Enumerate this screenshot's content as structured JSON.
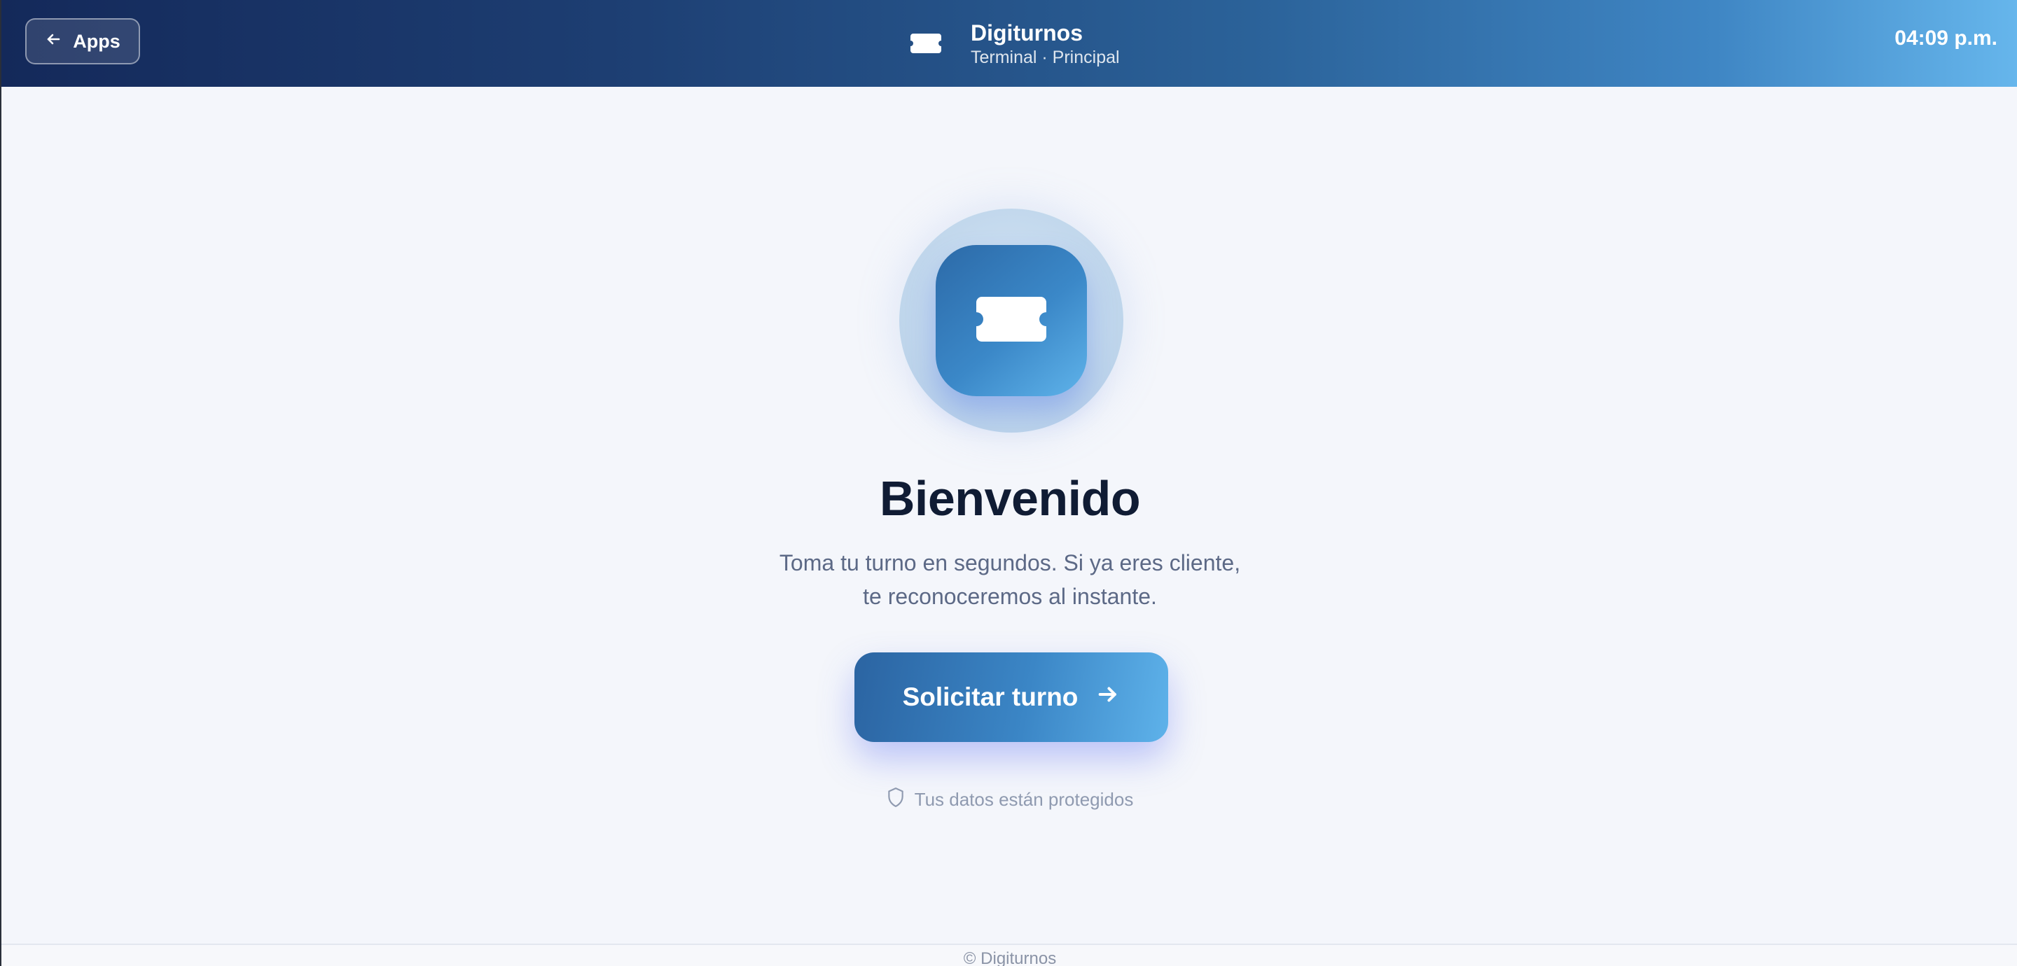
{
  "header": {
    "back_label": "Apps",
    "app_title": "Digiturnos",
    "app_subtitle": "Terminal · Principal",
    "clock": "04:09 p.m."
  },
  "main": {
    "title": "Bienvenido",
    "subtitle": "Toma tu turno en segundos. Si ya eres cliente, te reconoceremos al instante.",
    "cta_label": "Solicitar turno",
    "security_note": "Tus datos están protegidos"
  },
  "footer": {
    "text": "© Digiturnos"
  },
  "icons": {
    "back": "arrow-left-icon",
    "brand": "ticket-icon",
    "hero": "ticket-icon",
    "cta": "arrow-right-icon",
    "security": "shield-icon"
  },
  "colors": {
    "header_gradient_start": "#14295a",
    "header_gradient_end": "#66b6ec",
    "accent": "#3b86c6",
    "title": "#101c34",
    "background": "#f4f6fb"
  }
}
